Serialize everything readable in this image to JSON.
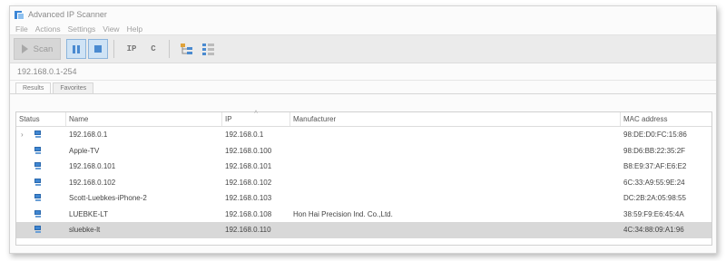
{
  "window": {
    "title": "Advanced IP Scanner",
    "icon": "app-icon"
  },
  "menu": [
    "File",
    "Actions",
    "Settings",
    "View",
    "Help"
  ],
  "toolbar": {
    "scan_label": "Scan",
    "ip_label": "IP",
    "c_label": "C"
  },
  "ip_range": "192.168.0.1-254",
  "tabs": [
    "Results",
    "Favorites"
  ],
  "columns": {
    "status": "Status",
    "name": "Name",
    "ip": "IP",
    "manufacturer": "Manufacturer",
    "mac": "MAC address"
  },
  "rows": [
    {
      "name": "192.168.0.1",
      "ip": "192.168.0.1",
      "manufacturer": "",
      "mac": "98:DE:D0:FC:15:86",
      "expandable": true
    },
    {
      "name": "Apple-TV",
      "ip": "192.168.0.100",
      "manufacturer": "",
      "mac": "98:D6:BB:22:35:2F"
    },
    {
      "name": "192.168.0.101",
      "ip": "192.168.0.101",
      "manufacturer": "",
      "mac": "B8:E9:37:AF:E6:E2"
    },
    {
      "name": "192.168.0.102",
      "ip": "192.168.0.102",
      "manufacturer": "",
      "mac": "6C:33:A9:55:9E:24"
    },
    {
      "name": "Scott-Luebkes-iPhone-2",
      "ip": "192.168.0.103",
      "manufacturer": "",
      "mac": "DC:2B:2A:05:98:55"
    },
    {
      "name": "LUEBKE-LT",
      "ip": "192.168.0.108",
      "manufacturer": "Hon Hai Precision Ind. Co.,Ltd.",
      "mac": "38:59:F9:E6:45:4A"
    },
    {
      "name": "sluebke-lt",
      "ip": "192.168.0.110",
      "manufacturer": "",
      "mac": "4C:34:88:09:A1:96",
      "selected": true
    }
  ],
  "colors": {
    "accent": "#3f86d2",
    "selected_row": "#d8d8d8",
    "toolbar_bg": "#ebebeb"
  }
}
